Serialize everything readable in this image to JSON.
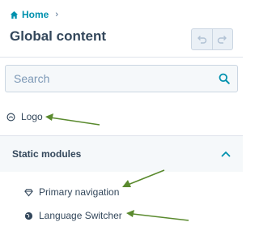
{
  "breadcrumb": {
    "home_label": "Home",
    "separator": "›"
  },
  "header": {
    "title": "Global content"
  },
  "search": {
    "placeholder": "Search",
    "value": ""
  },
  "modules": {
    "logo_label": "Logo",
    "static_section": {
      "title": "Static modules",
      "expanded": true,
      "items": [
        {
          "label": "Primary navigation",
          "icon": "diamond-icon"
        },
        {
          "label": "Language Switcher",
          "icon": "globe-icon"
        }
      ]
    }
  },
  "annotations": {
    "arrow_color": "#5a8a2e",
    "count": 3
  },
  "colors": {
    "accent": "#0091ae",
    "text": "#33475b",
    "border": "#cbd6e2",
    "panel_bg": "#f5f8fa"
  }
}
